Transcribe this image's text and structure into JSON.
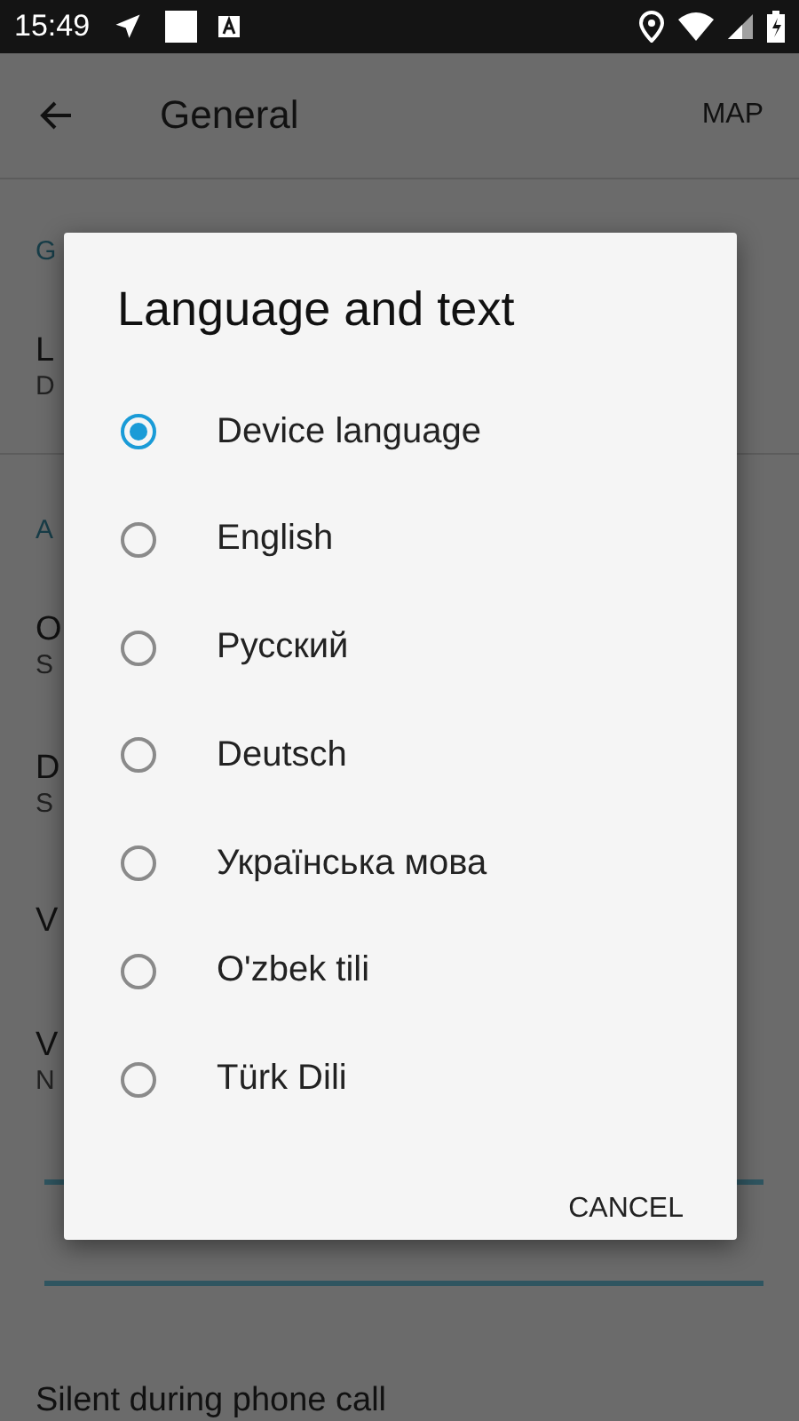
{
  "status_bar": {
    "time": "15:49"
  },
  "toolbar": {
    "title": "General",
    "action": "MAP"
  },
  "background_list": [
    {
      "kind": "header",
      "text": "G"
    },
    {
      "kind": "item",
      "title": "L",
      "subtitle": "D"
    },
    {
      "kind": "divider"
    },
    {
      "kind": "header",
      "text": "A"
    },
    {
      "kind": "item",
      "title": "O",
      "subtitle": "S"
    },
    {
      "kind": "item",
      "title": "D",
      "subtitle": "S"
    },
    {
      "kind": "item",
      "title": "V"
    },
    {
      "kind": "item",
      "title": "V",
      "subtitle": "N"
    },
    {
      "kind": "slider"
    },
    {
      "kind": "slider"
    },
    {
      "kind": "item",
      "title": "Silent during phone call"
    }
  ],
  "dialog": {
    "title": "Language and text",
    "options": [
      {
        "label": "Device language",
        "selected": true
      },
      {
        "label": "English",
        "selected": false
      },
      {
        "label": "Русский",
        "selected": false
      },
      {
        "label": "Deutsch",
        "selected": false
      },
      {
        "label": "Українська мова",
        "selected": false
      },
      {
        "label": "O'zbek tili",
        "selected": false
      },
      {
        "label": "Türk Dili",
        "selected": false
      }
    ],
    "button": "CANCEL"
  }
}
